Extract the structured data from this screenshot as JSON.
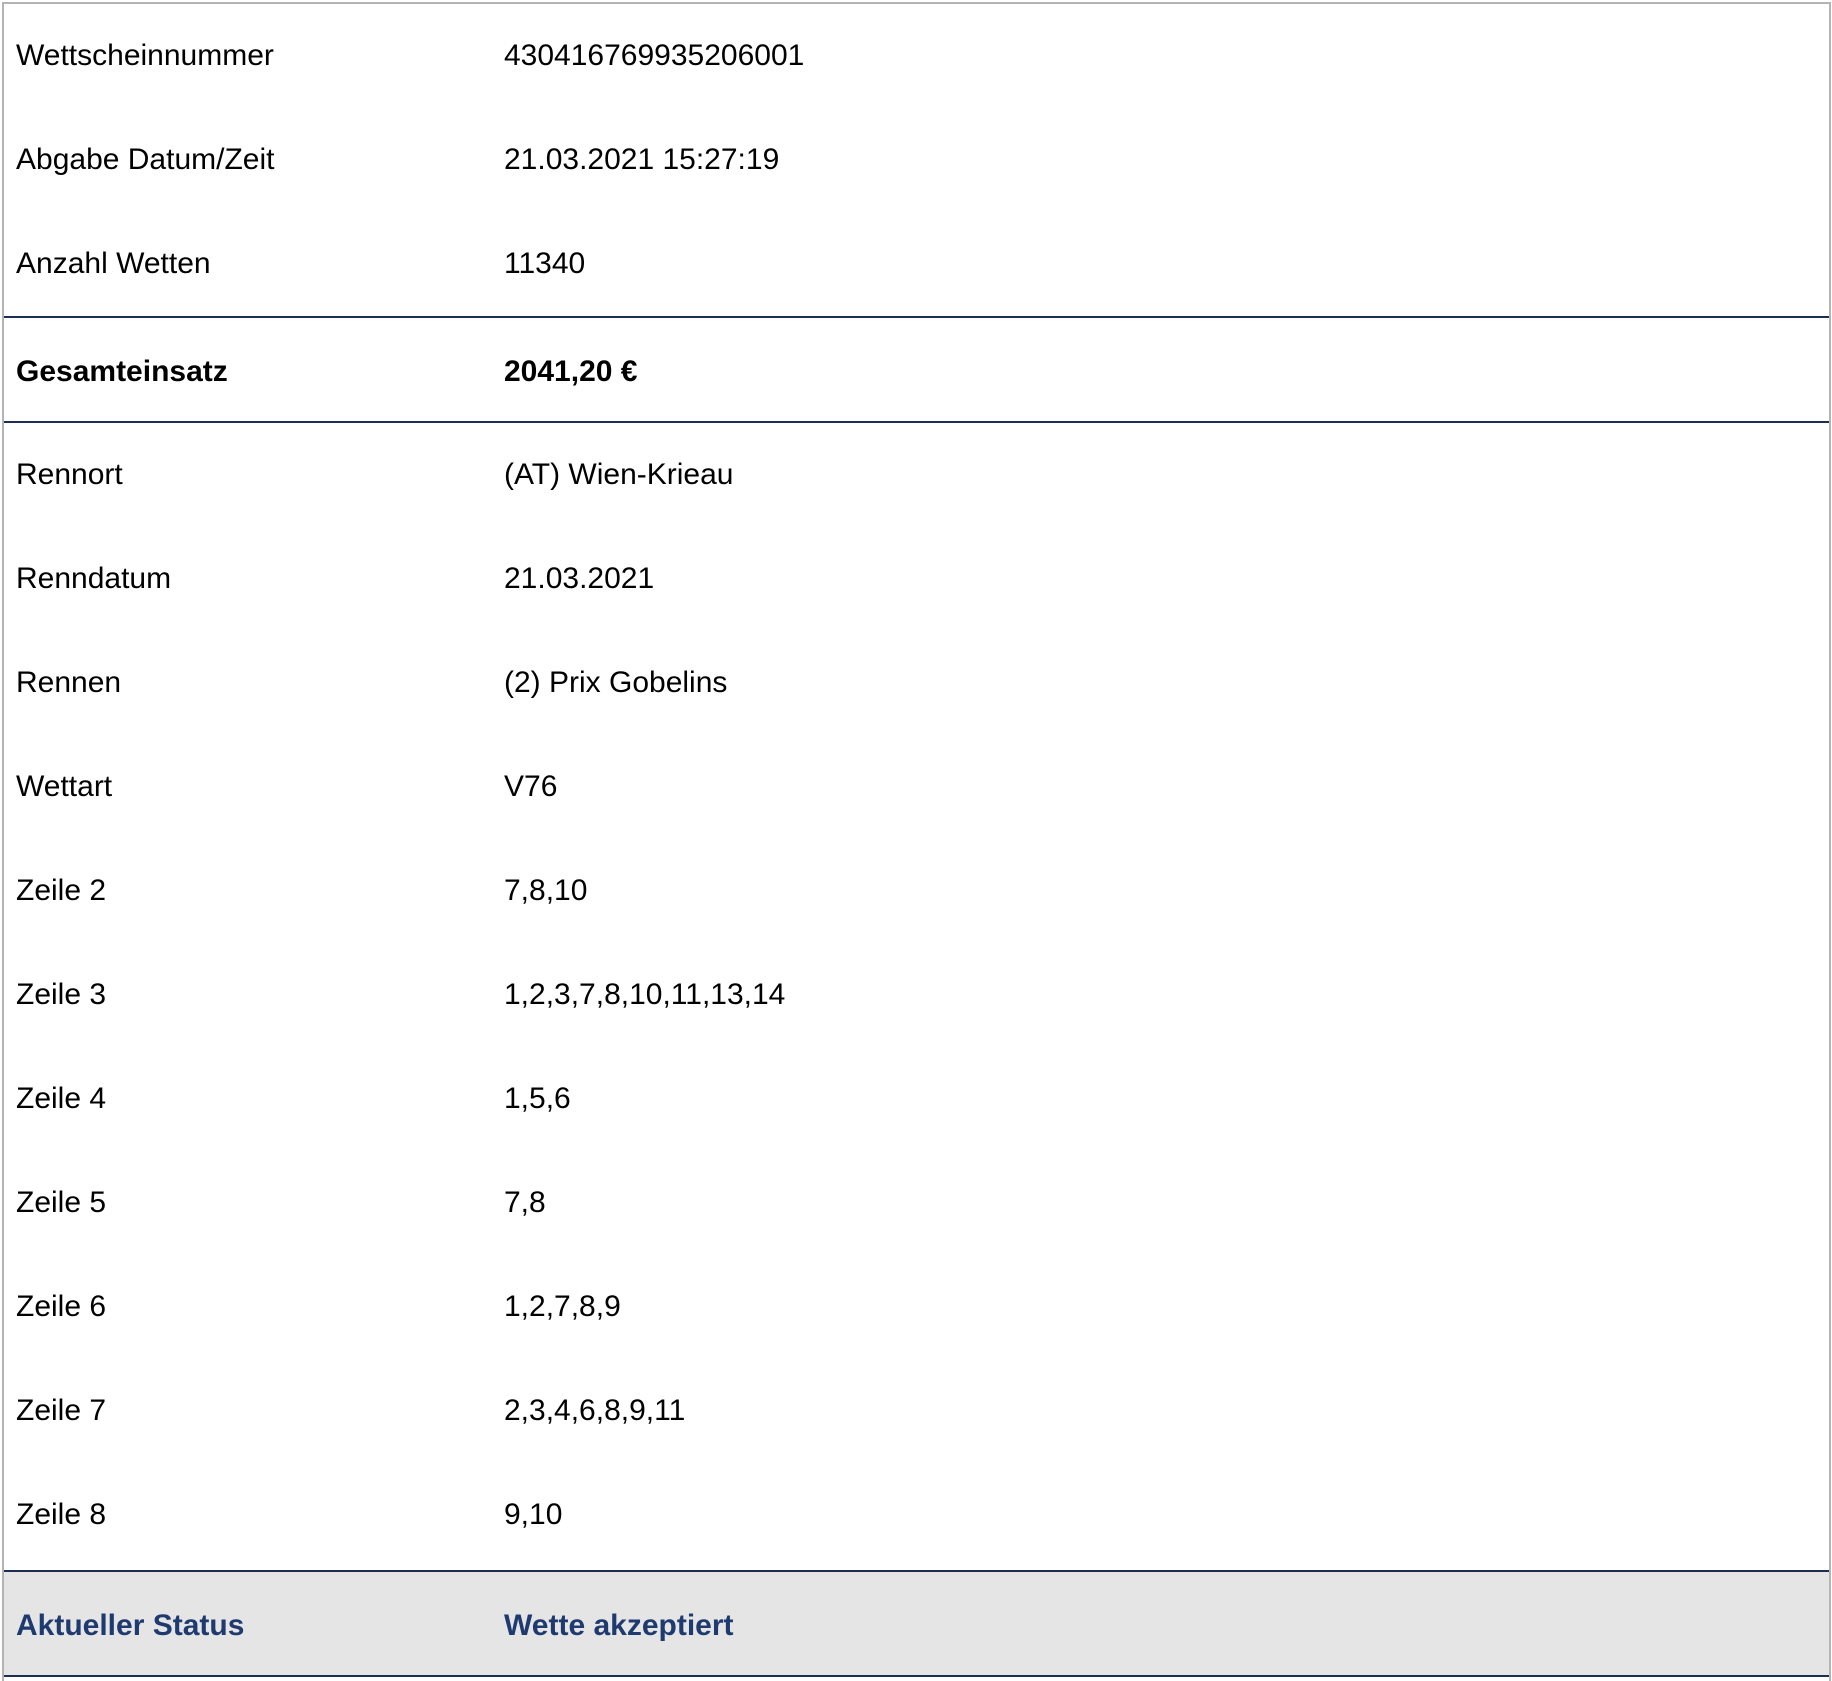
{
  "ticket": {
    "header_rows": [
      {
        "label": "Wettscheinnummer",
        "value": "430416769935206001"
      },
      {
        "label": "Abgabe Datum/Zeit",
        "value": "21.03.2021 15:27:19"
      },
      {
        "label": "Anzahl Wetten",
        "value": "11340"
      }
    ],
    "total": {
      "label": "Gesamteinsatz",
      "value": "2041,20 €"
    },
    "detail_rows": [
      {
        "label": "Rennort",
        "value": "(AT) Wien-Krieau"
      },
      {
        "label": "Renndatum",
        "value": "21.03.2021"
      },
      {
        "label": "Rennen",
        "value": "(2) Prix Gobelins"
      },
      {
        "label": "Wettart",
        "value": "V76"
      },
      {
        "label": "Zeile 2",
        "value": "7,8,10"
      },
      {
        "label": "Zeile 3",
        "value": "1,2,3,7,8,10,11,13,14"
      },
      {
        "label": "Zeile 4",
        "value": "1,5,6"
      },
      {
        "label": "Zeile 5",
        "value": "7,8"
      },
      {
        "label": "Zeile 6",
        "value": "1,2,7,8,9"
      },
      {
        "label": "Zeile 7",
        "value": "2,3,4,6,8,9,11"
      },
      {
        "label": "Zeile 8",
        "value": "9,10"
      }
    ],
    "status": {
      "label": "Aktueller Status",
      "value": "Wette akzeptiert"
    }
  },
  "colors": {
    "border": "#1b2f55",
    "status_text": "#1e3a6e",
    "status_background": "#e5e5e5"
  }
}
